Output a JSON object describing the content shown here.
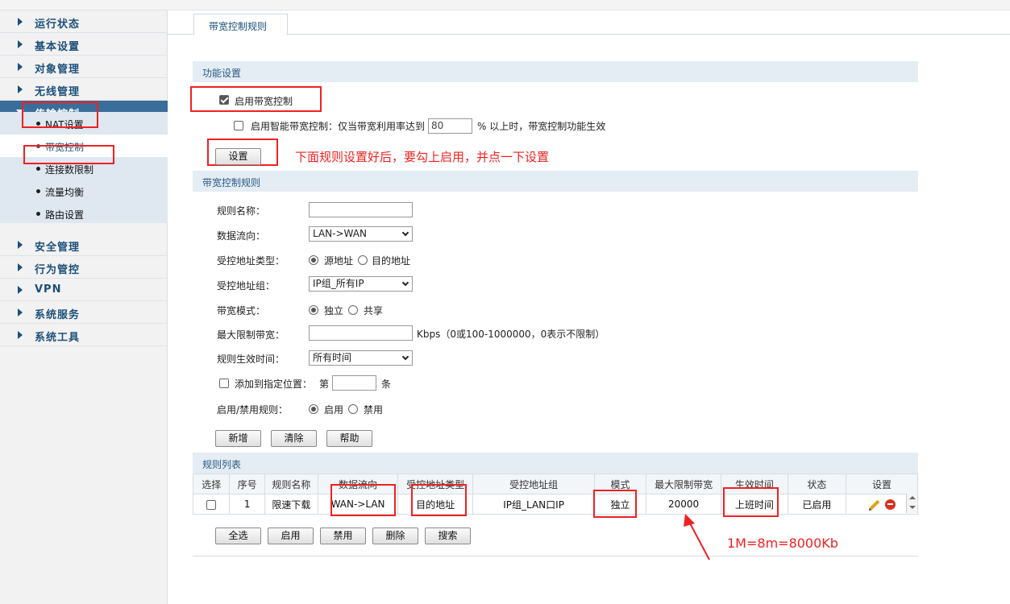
{
  "sidebar": {
    "items": [
      {
        "label": "运行状态"
      },
      {
        "label": "基本设置"
      },
      {
        "label": "对象管理"
      },
      {
        "label": "无线管理"
      },
      {
        "label": "传输控制"
      },
      {
        "label": "安全管理"
      },
      {
        "label": "行为管控"
      },
      {
        "label": "VPN"
      },
      {
        "label": "系统服务"
      },
      {
        "label": "系统工具"
      }
    ],
    "subitems": [
      {
        "label": "NAT设置"
      },
      {
        "label": "带宽控制"
      },
      {
        "label": "连接数限制"
      },
      {
        "label": "流量均衡"
      },
      {
        "label": "路由设置"
      }
    ]
  },
  "tab": {
    "label": "带宽控制规则"
  },
  "function": {
    "title": "功能设置",
    "enable_label": "启用带宽控制",
    "smart_label": "启用智能带宽控制：仅当带宽利用率达到",
    "smart_value": "80",
    "smart_suffix": "% 以上时，带宽控制功能生效",
    "set_button": "设置",
    "annotation": "下面规则设置好后，要勾上启用，并点一下设置"
  },
  "rules_form": {
    "title": "带宽控制规则",
    "name_label": "规则名称：",
    "direction_label": "数据流向：",
    "direction_value": "LAN->WAN",
    "addr_type_label": "受控地址类型：",
    "addr_src": "源地址",
    "addr_dst": "目的地址",
    "addr_group_label": "受控地址组：",
    "addr_group_value": "IP组_所有IP",
    "mode_label": "带宽模式：",
    "mode_exclusive": "独立",
    "mode_shared": "共享",
    "max_label": "最大限制带宽：",
    "max_hint": "Kbps（0或100-1000000，0表示不限制）",
    "time_label": "规则生效时间：",
    "time_value": "所有时间",
    "position_label": "添加到指定位置：",
    "position_prefix": "第",
    "position_suffix": "条",
    "enable_rule_label": "启用/禁用规则：",
    "enable_on": "启用",
    "enable_off": "禁用",
    "btn_add": "新增",
    "btn_clear": "清除",
    "btn_help": "帮助"
  },
  "rule_list": {
    "title": "规则列表",
    "headers": [
      "选择",
      "序号",
      "规则名称",
      "数据流向",
      "受控地址类型",
      "受控地址组",
      "模式",
      "最大限制带宽",
      "生效时间",
      "状态",
      "设置"
    ],
    "rows": [
      {
        "index": "1",
        "name": "限速下载",
        "direction": "WAN->LAN",
        "addr_type": "目的地址",
        "group": "IP组_LAN口IP",
        "mode": "独立",
        "max": "20000",
        "time": "上班时间",
        "status": "已启用"
      }
    ],
    "btn_select_all": "全选",
    "btn_enable": "启用",
    "btn_disable": "禁用",
    "btn_delete": "删除",
    "btn_search": "搜索"
  },
  "annotation_bottom": "1M=8m=8000Kb",
  "colors": {
    "accent": "#1c4f7a",
    "annotation": "#ee2222",
    "active_menu": "#3b6d9a"
  }
}
